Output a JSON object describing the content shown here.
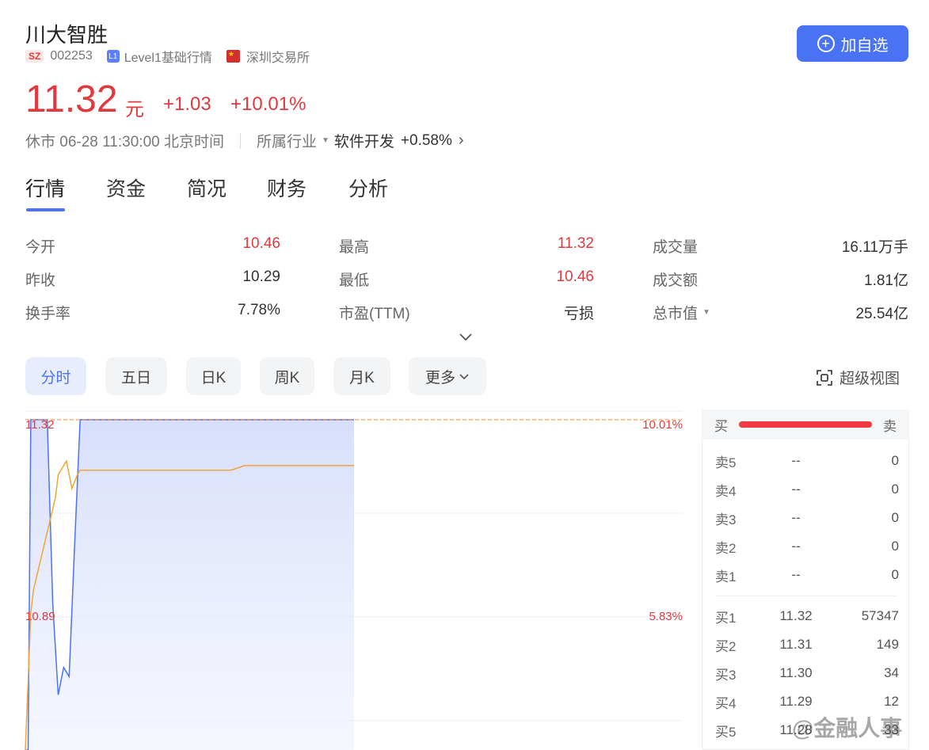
{
  "header": {
    "name": "川大智胜",
    "market_badge": "SZ",
    "code": "002253",
    "level_badge": "L1",
    "level_text": "Level1基础行情",
    "exchange": "深圳交易所",
    "add_button": "加自选"
  },
  "quote": {
    "price": "11.32",
    "unit": "元",
    "change": "+1.03",
    "change_pct": "+10.01%",
    "status": "休市 06-28 11:30:00 北京时间",
    "industry_label": "所属行业",
    "industry_name": "软件开发",
    "industry_pct": "+0.58%"
  },
  "tabs": [
    "行情",
    "资金",
    "简况",
    "财务",
    "分析"
  ],
  "stats": {
    "open_label": "今开",
    "open": "10.46",
    "high_label": "最高",
    "high": "11.32",
    "volume_label": "成交量",
    "volume": "16.11万手",
    "prev_close_label": "昨收",
    "prev_close": "10.29",
    "low_label": "最低",
    "low": "10.46",
    "amount_label": "成交额",
    "amount": "1.81亿",
    "turnover_label": "换手率",
    "turnover": "7.78%",
    "pe_label": "市盈(TTM)",
    "pe": "亏损",
    "mktcap_label": "总市值",
    "mktcap": "25.54亿"
  },
  "ranges": [
    "分时",
    "五日",
    "日K",
    "周K",
    "月K",
    "更多"
  ],
  "super_view": "超级视图",
  "chart_data": {
    "type": "line",
    "y_labels_left": [
      "11.32",
      "10.89"
    ],
    "y_labels_right": [
      "10.01%",
      "5.83%"
    ],
    "series": [
      {
        "color": "#4a72f5",
        "x": [
          0,
          1,
          2,
          8,
          10,
          12,
          14,
          16,
          18,
          20,
          45,
          120
        ],
        "values": [
          10.29,
          10.5,
          11.32,
          11.32,
          10.92,
          10.72,
          10.78,
          10.76,
          11.05,
          11.32,
          11.32,
          11.32
        ]
      },
      {
        "color": "#f0a53a",
        "x": [
          0,
          1,
          2,
          3,
          5,
          7,
          9,
          11,
          12,
          13,
          15,
          17,
          19,
          20,
          35,
          50,
          75,
          80,
          120
        ],
        "values": [
          10.29,
          10.75,
          10.9,
          10.95,
          11.0,
          11.05,
          11.1,
          11.15,
          11.2,
          11.21,
          11.23,
          11.17,
          11.2,
          11.21,
          11.21,
          11.21,
          11.21,
          11.22,
          11.22
        ]
      }
    ],
    "x_range": [
      0,
      240
    ],
    "y_max": 11.32
  },
  "orderbook": {
    "buy_label": "买",
    "sell_label": "卖",
    "asks": [
      {
        "label": "卖5",
        "price": "--",
        "vol": "0"
      },
      {
        "label": "卖4",
        "price": "--",
        "vol": "0"
      },
      {
        "label": "卖3",
        "price": "--",
        "vol": "0"
      },
      {
        "label": "卖2",
        "price": "--",
        "vol": "0"
      },
      {
        "label": "卖1",
        "price": "--",
        "vol": "0"
      }
    ],
    "bids": [
      {
        "label": "买1",
        "price": "11.32",
        "vol": "57347"
      },
      {
        "label": "买2",
        "price": "11.31",
        "vol": "149"
      },
      {
        "label": "买3",
        "price": "11.30",
        "vol": "34"
      },
      {
        "label": "买4",
        "price": "11.29",
        "vol": "12"
      },
      {
        "label": "买5",
        "price": "11.28",
        "vol": "33"
      }
    ]
  },
  "watermark": "@金融人事"
}
